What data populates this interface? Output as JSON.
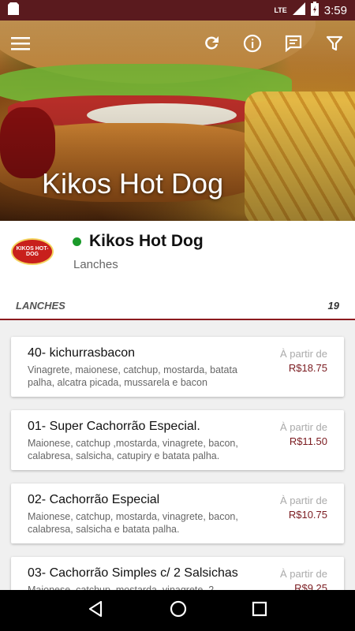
{
  "status_bar": {
    "network": "LTE",
    "battery_icon": "battery-charging-icon",
    "time": "3:59"
  },
  "header": {
    "title": "Kikos Hot Dog"
  },
  "store": {
    "logo_text": "KIKOS HOT-DOG",
    "name": "Kikos Hot Dog",
    "category": "Lanches",
    "status_color": "#1a9a2a"
  },
  "section": {
    "name": "LANCHES",
    "count": "19"
  },
  "items": [
    {
      "title": "40- kichurrasbacon",
      "desc": "Vinagrete, maionese, catchup, mostarda, batata palha, alcatra picada, mussarela e bacon",
      "from": "À partir de",
      "price": "R$18.75"
    },
    {
      "title": "01- Super Cachorrão Especial.",
      "desc": "Maionese, catchup ,mostarda, vinagrete, bacon, calabresa, salsicha, catupiry e batata palha.",
      "from": "À partir de",
      "price": "R$11.50"
    },
    {
      "title": "02- Cachorrão Especial",
      "desc": "Maionese, catchup, mostarda, vinagrete, bacon, calabresa, salsicha e batata palha.",
      "from": "À partir de",
      "price": "R$10.75"
    },
    {
      "title": "03- Cachorrão Simples c/ 2 Salsichas",
      "desc": "Maionese, catchup, mostarda, vinagrete, 2",
      "from": "À partir de",
      "price": "R$9.25"
    }
  ],
  "colors": {
    "primary": "#5a1a1e",
    "accent": "#8b1a1f",
    "price": "#7a1a1f"
  }
}
